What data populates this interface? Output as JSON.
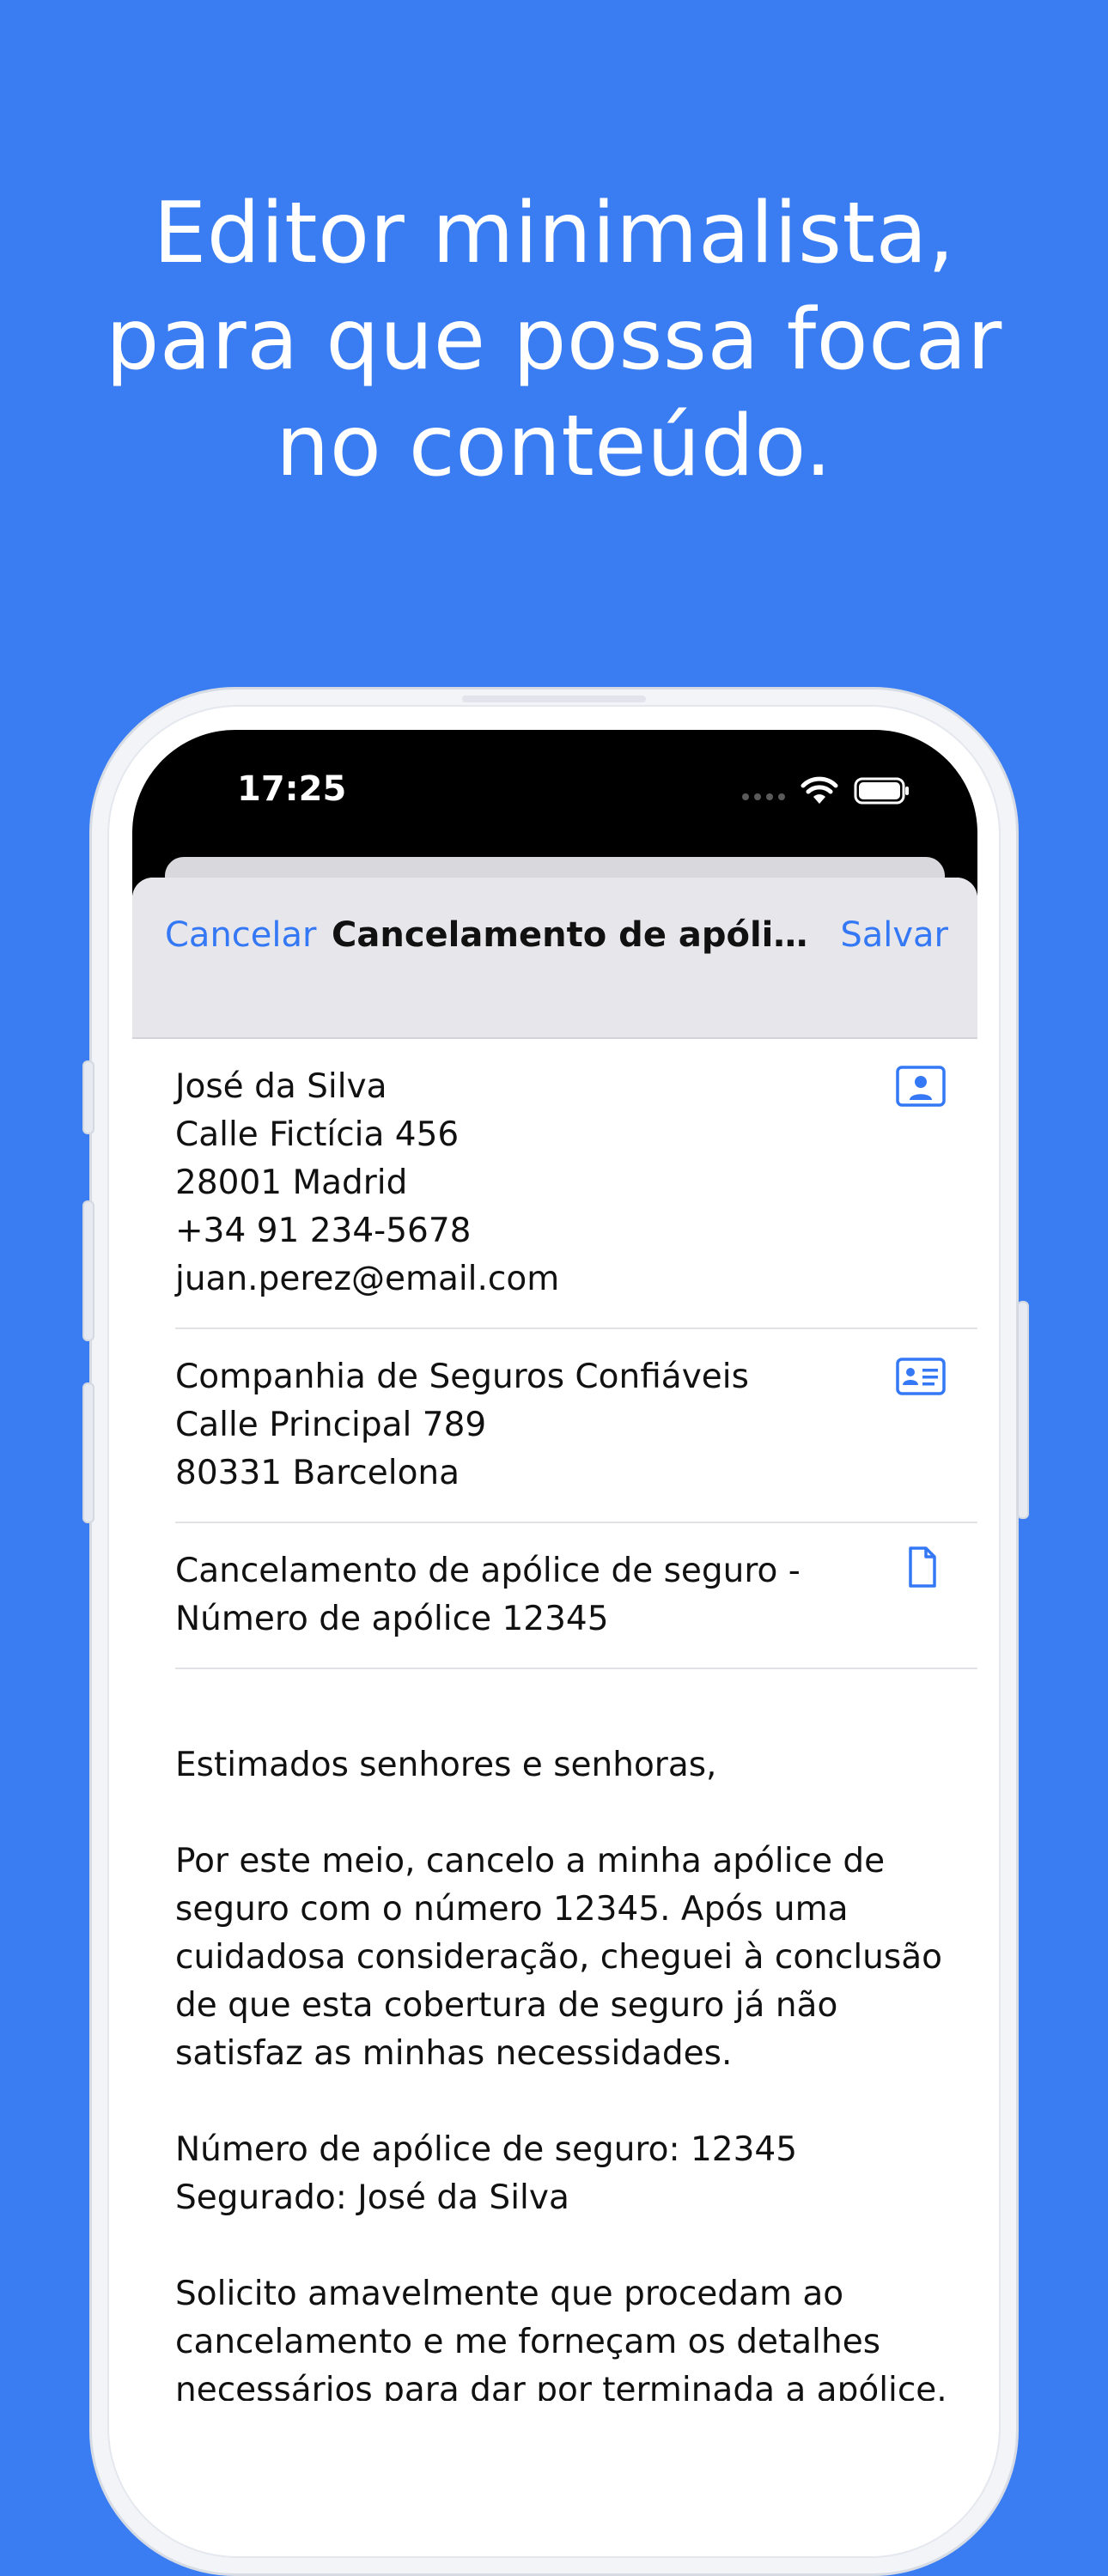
{
  "headline": {
    "lines": [
      "Editor minimalista,",
      "para que possa focar",
      "no conteúdo."
    ]
  },
  "status_bar": {
    "time": "17:25"
  },
  "nav": {
    "cancel_label": "Cancelar",
    "title": "Cancelamento de apólice de seguro",
    "save_label": "Salvar"
  },
  "sender": {
    "lines": [
      "José da Silva",
      "Calle Fictícia 456",
      "28001 Madrid",
      "+34 91 234-5678",
      "juan.perez@email.com"
    ],
    "icon": "contact-icon"
  },
  "recipient": {
    "lines": [
      "Companhia de Seguros Confiáveis",
      "Calle Principal 789",
      "80331 Barcelona"
    ],
    "icon": "address-card-icon"
  },
  "subject": {
    "lines": [
      "Cancelamento de apólice de seguro -",
      "Número de apólice 12345"
    ],
    "icon": "document-icon"
  },
  "body": {
    "paragraphs": [
      [
        "Estimados senhores e senhoras,"
      ],
      [
        "Por este meio, cancelo a minha apólice de",
        "seguro com o número 12345. Após uma",
        "cuidadosa consideração, cheguei à conclusão",
        "de que esta cobertura de seguro já não",
        "satisfaz as minhas necessidades."
      ],
      [
        "Número de apólice de seguro: 12345",
        "Segurado: José da Silva"
      ],
      [
        "Solicito amavelmente que procedam ao",
        "cancelamento e me forneçam os detalhes",
        "necessários para dar por terminada a apólice."
      ]
    ]
  },
  "colors": {
    "background": "#3A7DF2",
    "accent": "#3478F6",
    "navbar": "#E6E6EB"
  }
}
